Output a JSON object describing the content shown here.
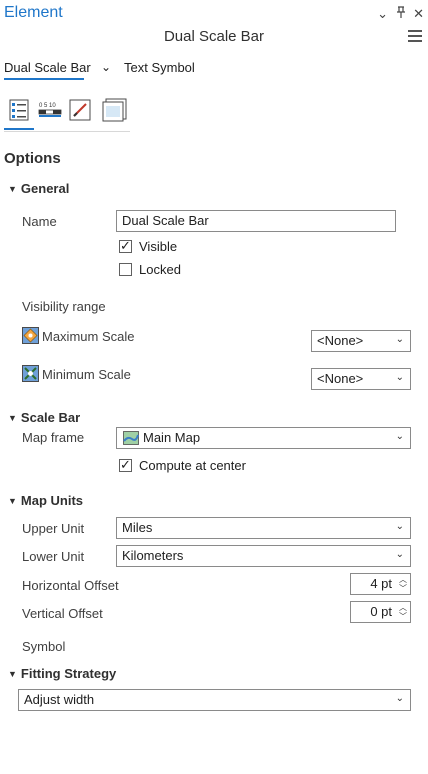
{
  "header": {
    "title": "Element",
    "minimize": "⌄",
    "pin": "ꟷ",
    "close": "✕",
    "subtitle": "Dual Scale Bar"
  },
  "element_tabs": {
    "active": "Dual Scale Bar",
    "chevron": "⌄",
    "other": "Text Symbol"
  },
  "section_options": "Options",
  "general": {
    "header": "General",
    "name_label": "Name",
    "name_value": "Dual Scale Bar",
    "visible_label": "Visible",
    "locked_label": "Locked",
    "visibility_range": "Visibility range",
    "max_scale_label": "Maximum Scale",
    "max_scale_value": "<None>",
    "min_scale_label": "Minimum Scale",
    "min_scale_value": "<None>"
  },
  "scale_bar": {
    "header": "Scale Bar",
    "map_frame_label": "Map frame",
    "map_frame_value": "Main Map",
    "compute_center_label": "Compute at center"
  },
  "map_units": {
    "header": "Map Units",
    "upper_unit_label": "Upper Unit",
    "upper_unit_value": "Miles",
    "lower_unit_label": "Lower Unit",
    "lower_unit_value": "Kilometers",
    "h_offset_label": "Horizontal Offset",
    "h_offset_value": "4 pt",
    "v_offset_label": "Vertical Offset",
    "v_offset_value": "0 pt",
    "symbol_label": "Symbol"
  },
  "fitting": {
    "header": "Fitting Strategy",
    "value": "Adjust width"
  },
  "colors": {
    "accent": "#1f76c9",
    "title": "#1f76c9",
    "border": "#8a8a8a"
  }
}
